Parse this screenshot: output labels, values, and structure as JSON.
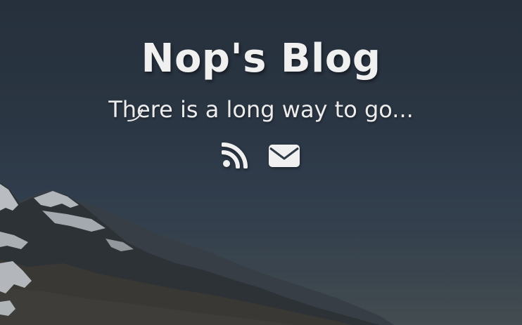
{
  "site": {
    "title": "Nop's Blog",
    "subtitle": "There is a long way to go..."
  },
  "social": [
    {
      "icon": "rss-icon"
    },
    {
      "icon": "envelope-icon"
    }
  ],
  "colors": {
    "text": "#f0f0f0",
    "sky_top": "#26303c",
    "sky_bottom": "#4b5356"
  }
}
